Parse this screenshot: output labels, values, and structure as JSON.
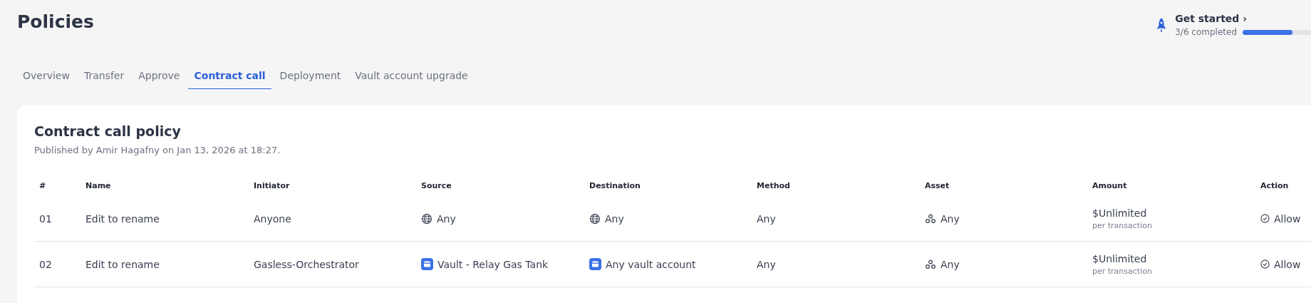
{
  "page": {
    "title": "Policies"
  },
  "get_started": {
    "title": "Get started",
    "chevron": "›",
    "progress_text": "3/6 completed",
    "level": 0.5
  },
  "tabs": [
    {
      "label": "Overview",
      "selected": false
    },
    {
      "label": "Transfer",
      "selected": false
    },
    {
      "label": "Approve",
      "selected": false
    },
    {
      "label": "Contract call",
      "selected": true
    },
    {
      "label": "Deployment",
      "selected": false
    },
    {
      "label": "Vault account upgrade",
      "selected": false
    }
  ],
  "policy": {
    "title": "Contract call policy",
    "subtitle": "Published by Amir Hagafny on Jan 13, 2026 at 18:27."
  },
  "table": {
    "columns": [
      "#",
      "Name",
      "Initiator",
      "Source",
      "Destination",
      "Method",
      "Asset",
      "Amount",
      "Action"
    ],
    "rows": [
      {
        "number": "01",
        "name": "Edit to rename",
        "initiator": "Anyone",
        "source": {
          "kind": "globe",
          "text": "Any"
        },
        "destination": {
          "kind": "globe",
          "text": "Any"
        },
        "method": "Any",
        "asset": {
          "kind": "coins",
          "text": "Any"
        },
        "amount": {
          "value": "$Unlimited",
          "note": "per transaction"
        },
        "action": {
          "kind": "check",
          "text": "Allow"
        }
      },
      {
        "number": "02",
        "name": "Edit to rename",
        "initiator": "Gasless-Orchestrator",
        "source": {
          "kind": "vault",
          "text": "Vault - Relay Gas Tank"
        },
        "destination": {
          "kind": "vault",
          "text": "Any vault account"
        },
        "method": "Any",
        "asset": {
          "kind": "coins",
          "text": "Any"
        },
        "amount": {
          "value": "$Unlimited",
          "note": "per transaction"
        },
        "action": {
          "kind": "check",
          "text": "Allow"
        }
      }
    ]
  }
}
